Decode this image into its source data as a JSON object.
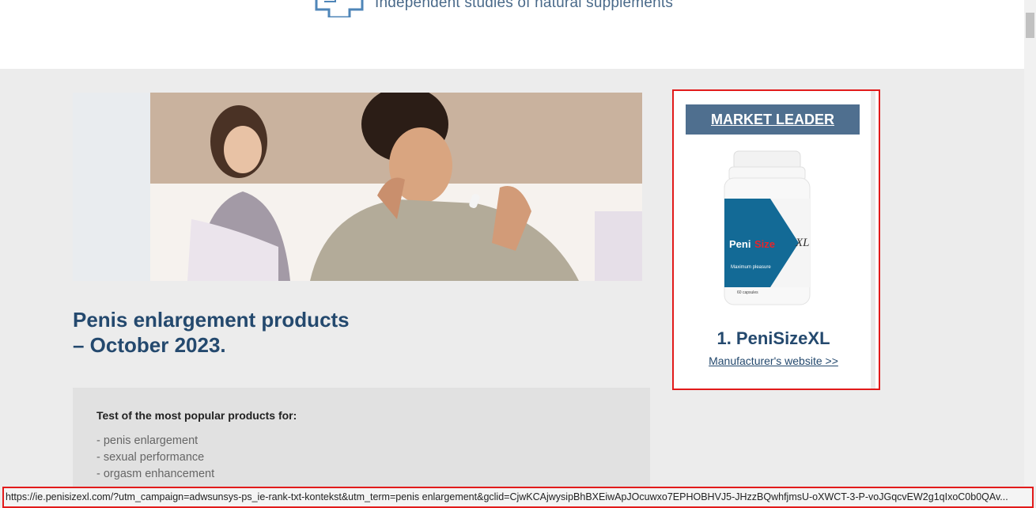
{
  "header": {
    "logo_icon": "medical-cross-icon",
    "tagline": "Independent studies of natural supplements"
  },
  "hero": {
    "image": "couple-in-bed-man-holding-pill-photo"
  },
  "article": {
    "title_line1": "Penis enlargement products",
    "title_line2": "– October 2023."
  },
  "test_box": {
    "heading": "Test of the most popular products for:",
    "items": [
      "- penis enlargement",
      "- sexual performance",
      "- orgasm enhancement"
    ]
  },
  "sidebar": {
    "banner_label": "MARKET LEADER",
    "product_image": "penisizexl-bottle",
    "bottle_brand_left": "Peni",
    "bottle_brand_right": "Size",
    "bottle_suffix": "XL",
    "bottle_subtitle": "Maximum pleasure",
    "bottle_capsules": "60 capsules",
    "product_name": "1. PeniSizeXL",
    "manufacturer_link": "Manufacturer's website >>"
  },
  "status_bar": {
    "url": "https://ie.penisizexl.com/?utm_campaign=adwsunsys-ps_ie-rank-txt-kontekst&utm_term=penis enlargement&gclid=CjwKCAjwysipBhBXEiwApJOcuwxo7EPHOBHVJ5-JHzzBQwhfjmsU-oXWCT-3-P-voJGqcvEW2g1qIxoC0b0QAv..."
  },
  "colors": {
    "brand_navy": "#24496e",
    "banner_blue": "#4f6f8f",
    "highlight_red": "#e21b1b",
    "page_bg": "#ececec"
  }
}
